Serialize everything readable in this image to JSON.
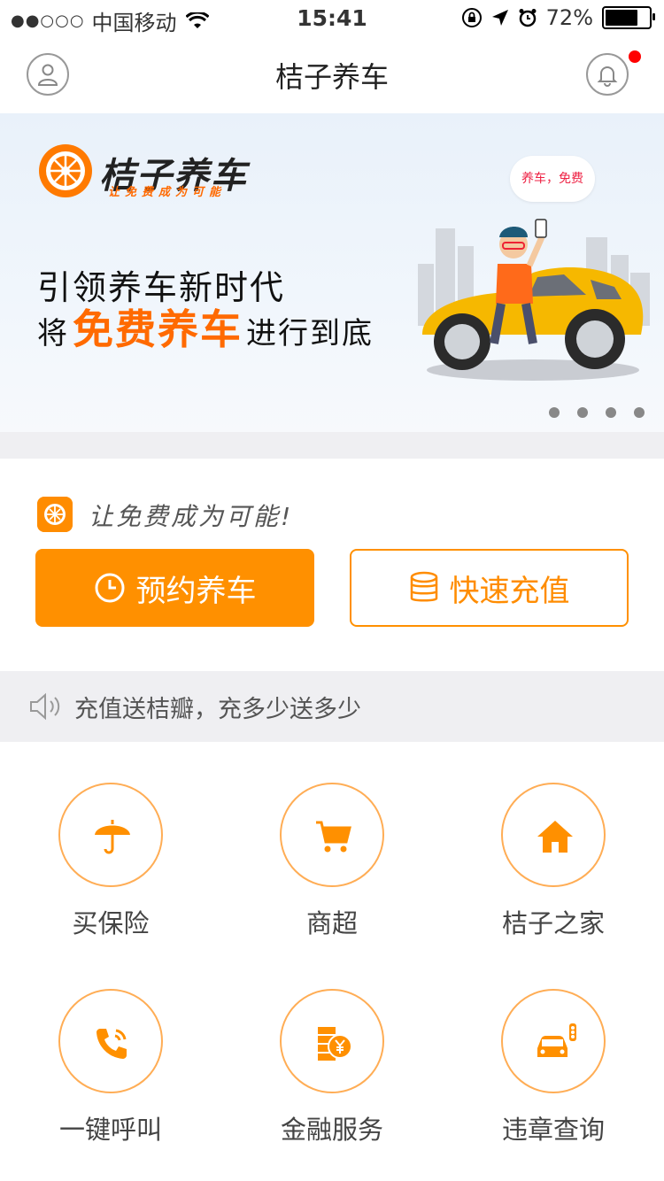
{
  "status_bar": {
    "signal": "●●○○○",
    "carrier": "中国移动",
    "time": "15:41",
    "battery": "72%"
  },
  "nav": {
    "title": "桔子养车"
  },
  "banner": {
    "logo_name": "桔子养车",
    "logo_slogan": "让免费成为可能",
    "line1": "引领养车新时代",
    "line2_prefix": "将",
    "line2_highlight": "免费养车",
    "line2_suffix": "进行到底",
    "bubble": "养车，免费",
    "page_count": 4
  },
  "slogan": {
    "text": "让免费成为可能!"
  },
  "actions": {
    "book_label": "预约养车",
    "recharge_label": "快速充值"
  },
  "notice": {
    "text": "充值送桔瓣，充多少送多少"
  },
  "services": [
    {
      "label": "买保险",
      "icon": "umbrella-icon"
    },
    {
      "label": "商超",
      "icon": "cart-icon"
    },
    {
      "label": "桔子之家",
      "icon": "home-icon"
    },
    {
      "label": "一键呼叫",
      "icon": "phone-icon"
    },
    {
      "label": "金融服务",
      "icon": "finance-icon"
    },
    {
      "label": "违章查询",
      "icon": "car-violation-icon"
    }
  ],
  "colors": {
    "accent": "#ff9000",
    "highlight": "#ff6a00",
    "badge": "#ff0000"
  }
}
